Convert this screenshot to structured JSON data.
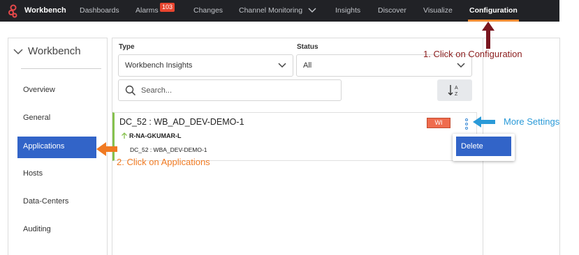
{
  "nav": {
    "brand": "Workbench",
    "items": [
      "Dashboards",
      "Alarms",
      "Changes",
      "Channel Monitoring",
      "Insights",
      "Discover",
      "Visualize",
      "Configuration"
    ],
    "alarms_badge": "103",
    "active": "Configuration"
  },
  "sidebar": {
    "title": "Workbench",
    "items": [
      "Overview",
      "General",
      "Applications",
      "Hosts",
      "Data-Centers",
      "Auditing"
    ],
    "active": "Applications"
  },
  "filters": {
    "type_label": "Type",
    "type_value": "Workbench Insights",
    "status_label": "Status",
    "status_value": "All",
    "search_placeholder": "Search..."
  },
  "card": {
    "title": "DC_52 : WB_AD_DEV-DEMO-1",
    "host": "R-NA-GKUMAR-L",
    "sub": "DC_52 : WBA_DEV-DEMO-1",
    "badge": "WI"
  },
  "menu": {
    "delete": "Delete"
  },
  "annotations": {
    "step1": "1. Click on Configuration",
    "step2": "2. Click on Applications",
    "more": "More Settings"
  },
  "colors": {
    "nav_bg": "#212226",
    "accent": "#3264c8",
    "active_underline": "#f08c34",
    "step1": "#8b1c1c",
    "step2": "#f07a22",
    "more": "#2a9ad8",
    "status_bar": "#86c14e"
  }
}
